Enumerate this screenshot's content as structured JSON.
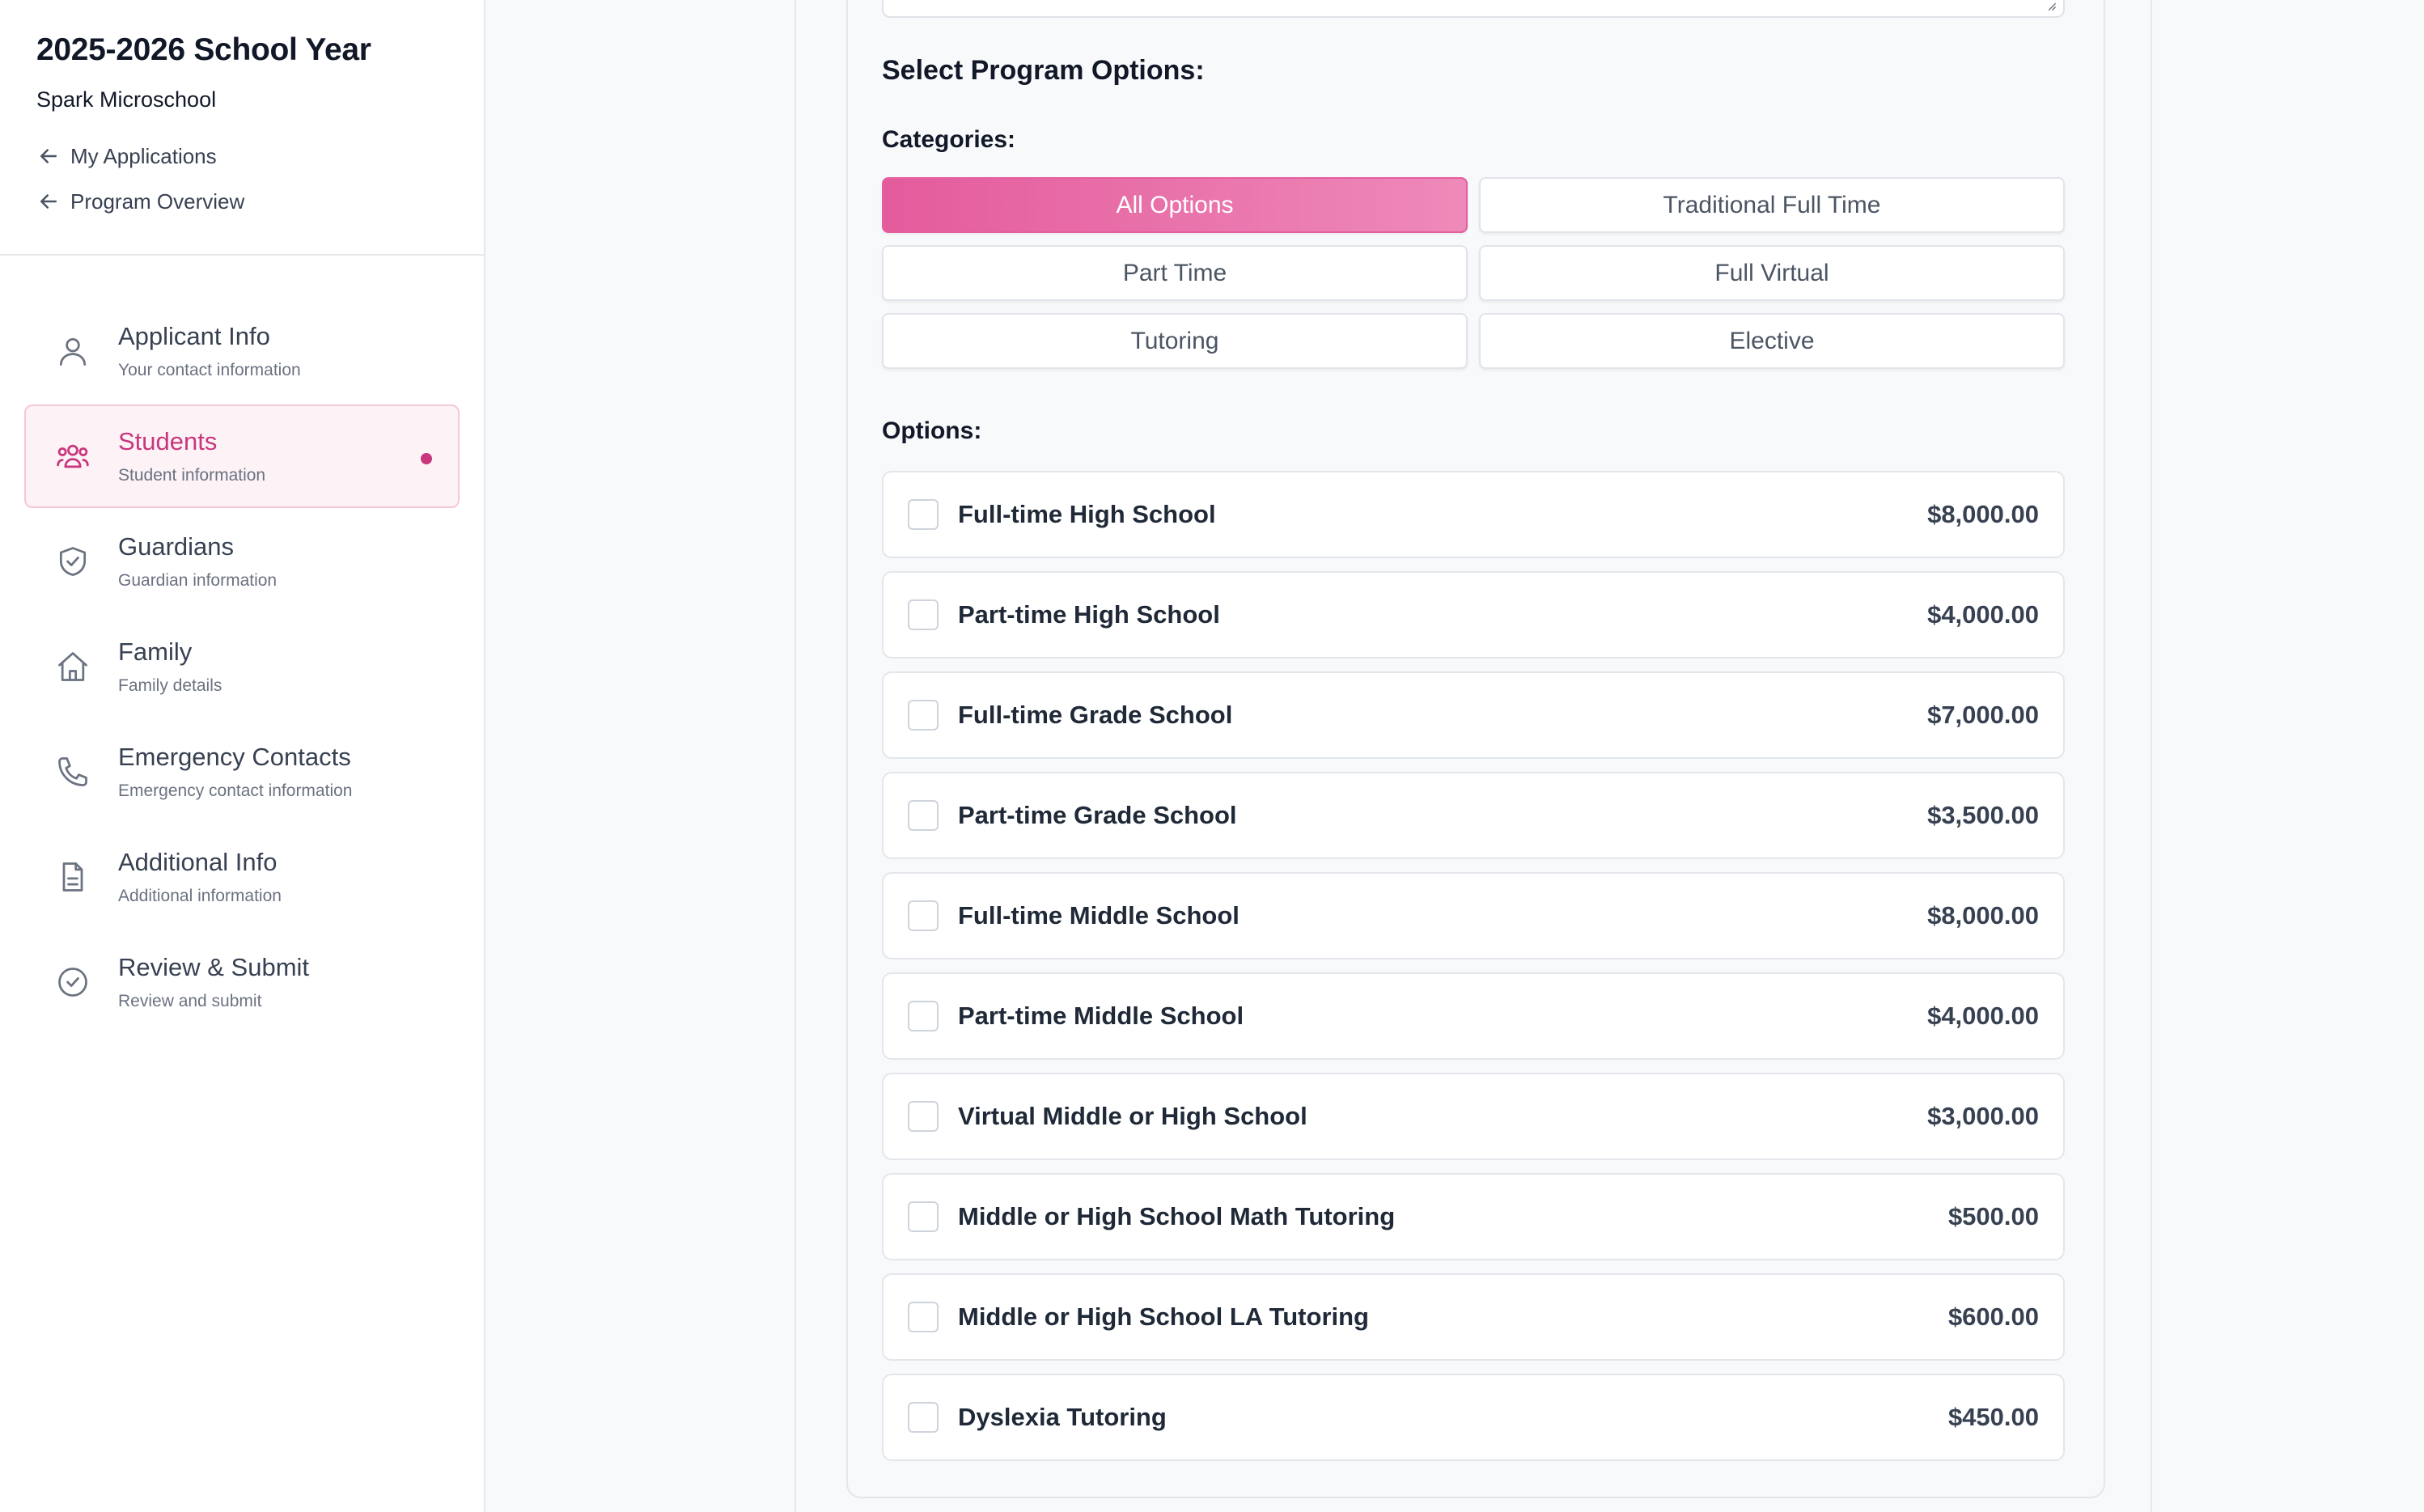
{
  "sidebar": {
    "year_title": "2025-2026 School Year",
    "school_name": "Spark Microschool",
    "back_links": [
      "My Applications",
      "Program Overview"
    ],
    "items": [
      {
        "label": "Applicant Info",
        "sub": "Your contact information",
        "icon": "user-icon"
      },
      {
        "label": "Students",
        "sub": "Student information",
        "icon": "users-icon",
        "active": true
      },
      {
        "label": "Guardians",
        "sub": "Guardian information",
        "icon": "shield-check-icon"
      },
      {
        "label": "Family",
        "sub": "Family details",
        "icon": "home-icon"
      },
      {
        "label": "Emergency Contacts",
        "sub": "Emergency contact information",
        "icon": "phone-icon"
      },
      {
        "label": "Additional Info",
        "sub": "Additional information",
        "icon": "document-icon"
      },
      {
        "label": "Review & Submit",
        "sub": "Review and submit",
        "icon": "check-circle-icon"
      }
    ]
  },
  "main": {
    "section_title": "Select Program Options:",
    "categories_label": "Categories:",
    "categories": [
      "All Options",
      "Traditional Full Time",
      "Part Time",
      "Full Virtual",
      "Tutoring",
      "Elective"
    ],
    "active_category": "All Options",
    "options_label": "Options:",
    "options": [
      {
        "name": "Full-time High School",
        "price": "$8,000.00"
      },
      {
        "name": "Part-time High School",
        "price": "$4,000.00"
      },
      {
        "name": "Full-time Grade School",
        "price": "$7,000.00"
      },
      {
        "name": "Part-time Grade School",
        "price": "$3,500.00"
      },
      {
        "name": "Full-time Middle School",
        "price": "$8,000.00"
      },
      {
        "name": "Part-time Middle School",
        "price": "$4,000.00"
      },
      {
        "name": "Virtual Middle or High School",
        "price": "$3,000.00"
      },
      {
        "name": "Middle or High School Math Tutoring",
        "price": "$500.00"
      },
      {
        "name": "Middle or High School LA Tutoring",
        "price": "$600.00"
      },
      {
        "name": "Dyslexia Tutoring",
        "price": "$450.00"
      }
    ]
  },
  "colors": {
    "accent": "#e55ea0",
    "active_text": "#c8377d"
  }
}
